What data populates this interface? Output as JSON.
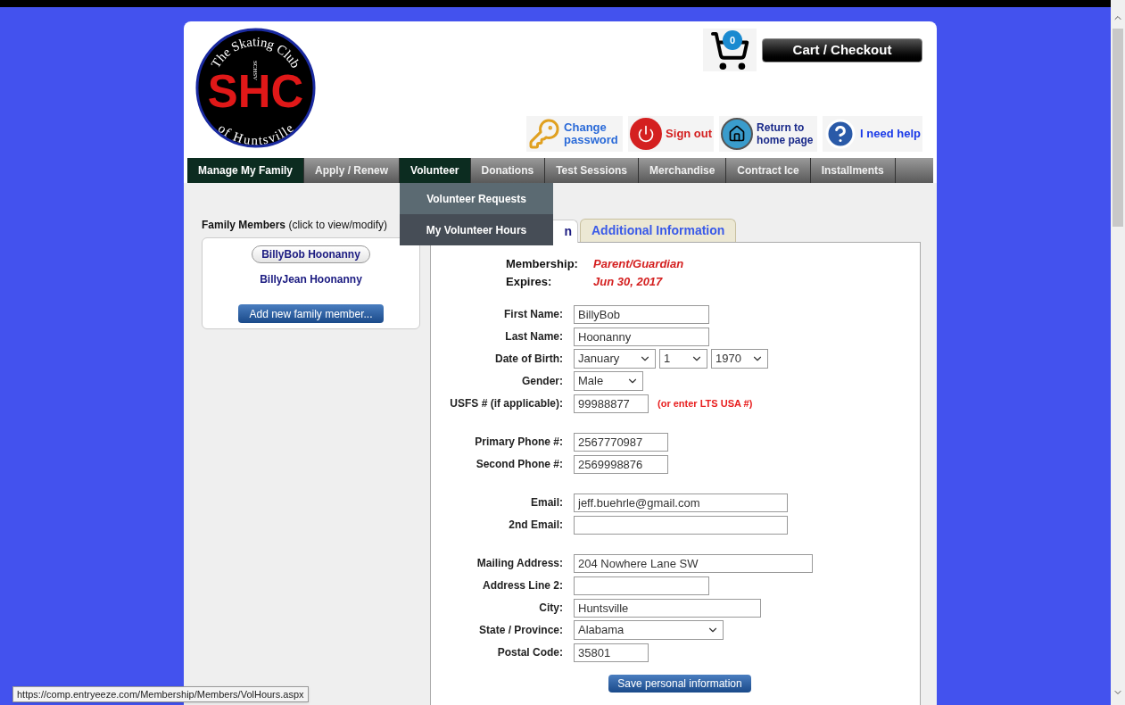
{
  "logo": {
    "top_text": "The Skating Club",
    "bottom_text": "of Huntsville",
    "initials": "SHC",
    "vertical_text": "SCHSV"
  },
  "cart": {
    "count": "0",
    "button": "Cart / Checkout"
  },
  "header_links": [
    {
      "kind": "password",
      "label": "Change password"
    },
    {
      "kind": "signout",
      "label": "Sign out"
    },
    {
      "kind": "home",
      "label": "Return to home page"
    },
    {
      "kind": "help",
      "label": "I need help"
    }
  ],
  "nav": [
    {
      "label": "Manage My Family",
      "selected": true
    },
    {
      "label": "Apply / Renew",
      "selected": false
    },
    {
      "label": "Volunteer",
      "selected": true,
      "menu": [
        {
          "label": "Volunteer Requests",
          "highlighted": false
        },
        {
          "label": "My Volunteer Hours",
          "highlighted": true
        }
      ]
    },
    {
      "label": "Donations",
      "selected": false
    },
    {
      "label": "Test Sessions",
      "selected": false
    },
    {
      "label": "Merchandise",
      "selected": false
    },
    {
      "label": "Contract Ice",
      "selected": false
    },
    {
      "label": "Installments",
      "selected": false
    }
  ],
  "family": {
    "heading": "**Family Members** (click to view/modify)",
    "members": [
      {
        "name": "BillyBob Hoonanny",
        "selected": true
      },
      {
        "name": "BillyJean Hoonanny",
        "selected": false
      }
    ],
    "add_button": "Add new family member..."
  },
  "tabs": [
    {
      "label": "n",
      "selected": true
    },
    {
      "label": "Additional Information",
      "selected": false
    }
  ],
  "membership": [
    {
      "label": "Membership:",
      "value": "Parent/Guardian"
    },
    {
      "label": "Expires:",
      "value": "Jun 30, 2017"
    }
  ],
  "form_groups": [
    [
      {
        "label": "First Name:",
        "controls": [
          {
            "kind": "text",
            "value": "BillyBob"
          }
        ]
      },
      {
        "label": "Last Name:",
        "controls": [
          {
            "kind": "text",
            "value": "Hoonanny"
          }
        ]
      },
      {
        "label": "Date of Birth:",
        "controls": [
          {
            "kind": "select",
            "value": "January"
          },
          {
            "kind": "select",
            "value": "1"
          },
          {
            "kind": "select",
            "value": "1970"
          }
        ]
      },
      {
        "label": "Gender:",
        "controls": [
          {
            "kind": "select",
            "value": "Male"
          }
        ]
      },
      {
        "label": "USFS # (if applicable):",
        "controls": [
          {
            "kind": "text",
            "value": "99988877"
          }
        ],
        "note": "(or enter LTS USA #)"
      }
    ],
    [
      {
        "label": "Primary Phone #:",
        "controls": [
          {
            "kind": "text",
            "value": "2567770987"
          }
        ]
      },
      {
        "label": "Second Phone #:",
        "controls": [
          {
            "kind": "text",
            "value": "2569998876"
          }
        ]
      }
    ],
    [
      {
        "label": "Email:",
        "controls": [
          {
            "kind": "text",
            "value": "jeff.buehrle@gmail.com"
          }
        ]
      },
      {
        "label": "2nd Email:",
        "controls": [
          {
            "kind": "text"
          }
        ]
      }
    ],
    [
      {
        "label": "Mailing Address:",
        "controls": [
          {
            "kind": "text",
            "value": "204 Nowhere Lane SW"
          }
        ]
      },
      {
        "label": "Address Line 2:",
        "controls": [
          {
            "kind": "text"
          }
        ]
      },
      {
        "label": "City:",
        "controls": [
          {
            "kind": "text",
            "value": "Huntsville"
          }
        ]
      },
      {
        "label": "State / Province:",
        "controls": [
          {
            "kind": "select",
            "value": "Alabama"
          }
        ]
      },
      {
        "label": "Postal Code:",
        "controls": [
          {
            "kind": "text",
            "value": "35801"
          }
        ]
      }
    ]
  ],
  "save_button": "Save personal information",
  "status_url": "https://comp.entryeeze.com/Membership/Members/VolHours.aspx"
}
